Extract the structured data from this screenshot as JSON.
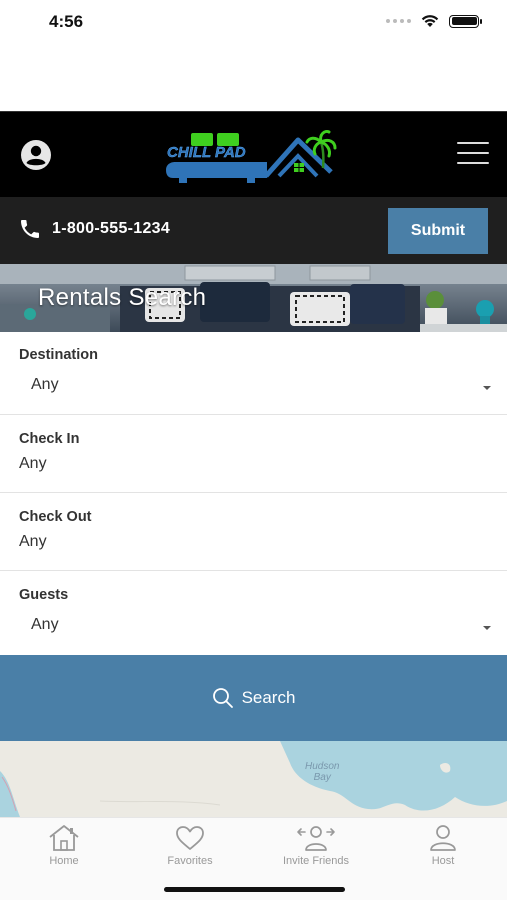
{
  "status_bar": {
    "time": "4:56"
  },
  "header": {
    "logo_text": "CHILL PAD",
    "profile_icon": "account-circle-icon",
    "menu_icon": "hamburger-menu-icon"
  },
  "contact_bar": {
    "phone": "1-800-555-1234",
    "phone_icon": "phone-icon",
    "submit_label": "Submit"
  },
  "hero": {
    "title": "Rentals Search"
  },
  "form": {
    "destination": {
      "label": "Destination",
      "value": "Any"
    },
    "check_in": {
      "label": "Check In",
      "value": "Any"
    },
    "check_out": {
      "label": "Check Out",
      "value": "Any"
    },
    "guests": {
      "label": "Guests",
      "value": "Any"
    },
    "search_label": "Search"
  },
  "map": {
    "label_line1": "Hudson",
    "label_line2": "Bay"
  },
  "tabs": [
    {
      "label": "Home",
      "icon": "home-icon"
    },
    {
      "label": "Favorites",
      "icon": "heart-icon"
    },
    {
      "label": "Invite Friends",
      "icon": "invite-friends-icon"
    },
    {
      "label": "Host",
      "icon": "person-icon"
    }
  ],
  "colors": {
    "accent": "#4a7fa7",
    "header_bg": "#000000",
    "contact_bg": "#1f1f1f",
    "logo_green": "#3fcf1f",
    "logo_blue": "#2f74b8"
  }
}
